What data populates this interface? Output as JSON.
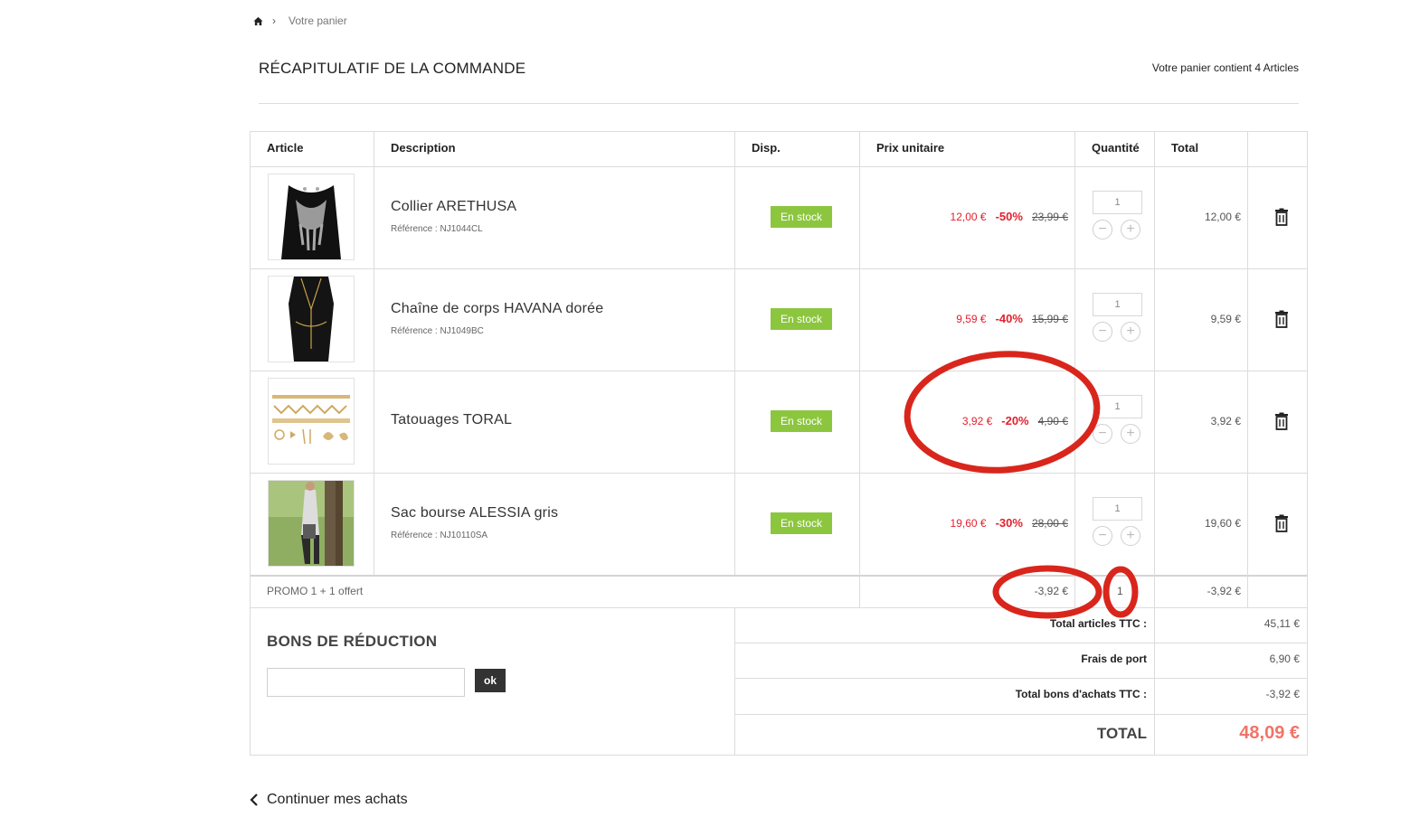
{
  "breadcrumb": {
    "home_icon": "home-icon",
    "separator": "›",
    "current": "Votre panier"
  },
  "header": {
    "title": "RÉCAPITULATIF DE LA COMMANDE",
    "cart_count": "Votre panier contient 4 Articles"
  },
  "table": {
    "columns": [
      "Article",
      "Description",
      "Disp.",
      "Prix unitaire",
      "Quantité",
      "Total"
    ],
    "rows": [
      {
        "name": "Collier ARETHUSA",
        "ref": "Référence : NJ1044CL",
        "stock": "En stock",
        "price": "12,00 €",
        "discount": "-50%",
        "old_price": "23,99 €",
        "qty": "1",
        "total": "12,00 €"
      },
      {
        "name": "Chaîne de corps HAVANA dorée",
        "ref": "Référence : NJ1049BC",
        "stock": "En stock",
        "price": "9,59 €",
        "discount": "-40%",
        "old_price": "15,99 €",
        "qty": "1",
        "total": "9,59 €"
      },
      {
        "name": "Tatouages TORAL",
        "ref": "",
        "stock": "En stock",
        "price": "3,92 €",
        "discount": "-20%",
        "old_price": "4,90 €",
        "qty": "1",
        "total": "3,92 €"
      },
      {
        "name": "Sac bourse ALESSIA gris",
        "ref": "Référence : NJ10110SA",
        "stock": "En stock",
        "price": "19,60 €",
        "discount": "-30%",
        "old_price": "28,00 €",
        "qty": "1",
        "total": "19,60 €"
      }
    ],
    "promo": {
      "label": "PROMO 1 + 1 offert",
      "unit": "-3,92 €",
      "qty": "1",
      "total": "-3,92 €"
    },
    "qty_minus": "−",
    "qty_plus": "+"
  },
  "vouchers": {
    "title": "BONS DE RÉDUCTION",
    "input_value": "",
    "ok_label": "ok"
  },
  "summary": {
    "articles_label": "Total articles TTC :",
    "articles_value": "45,11 €",
    "shipping_label": "Frais de port",
    "shipping_value": "6,90 €",
    "vouchers_label": "Total bons d'achats TTC :",
    "vouchers_value": "-3,92 €",
    "total_label": "TOTAL",
    "total_value": "48,09 €"
  },
  "footer": {
    "continue_label": "Continuer mes achats"
  },
  "colors": {
    "accent_red": "#e4202d",
    "stock_green": "#8cc63f",
    "total_salmon": "#f07468",
    "annotation_red": "#d9261c"
  }
}
